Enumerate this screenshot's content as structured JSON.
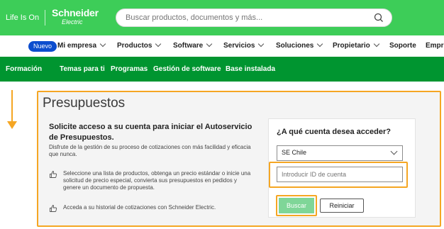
{
  "header": {
    "life_is_on": "Life Is On",
    "brand_name": "Schneider",
    "brand_sub": "Electric",
    "search_placeholder": "Buscar productos, documentos y más...",
    "colors": {
      "brand_green": "#3dcd58",
      "subnav_green": "#009530",
      "highlight": "#f5a623"
    }
  },
  "nav": {
    "badge": "Nuevo",
    "items": [
      "Mi empresa",
      "Productos",
      "Software",
      "Servicios",
      "Soluciones",
      "Propietario",
      "Soporte",
      "Empr"
    ]
  },
  "subnav": {
    "items": [
      "Formación",
      "Temas para ti",
      "Programas",
      "Gestión de software",
      "Base instalada"
    ]
  },
  "page": {
    "title": "Presupuestos",
    "left": {
      "heading": "Solicite acceso a su cuenta para iniciar el Autoservicio de Presupuestos.",
      "subtitle": "Disfrute de la gestión de su proceso de cotizaciones con más facilidad y eficacia que nunca.",
      "bullets": [
        "Seleccione una lista de productos, obtenga un precio estándar o inicie una solicitud de precio especial, convierta sus presupuestos en pedidos y genere un documento de propuesta.",
        "Acceda a su historial de cotizaciones con Schneider Electric."
      ]
    },
    "right": {
      "heading": "¿A qué cuenta desea acceder?",
      "select_value": "SE Chile",
      "account_placeholder": "Introducir ID de cuenta",
      "search_button": "Buscar",
      "reset_button": "Reiniciar"
    }
  }
}
